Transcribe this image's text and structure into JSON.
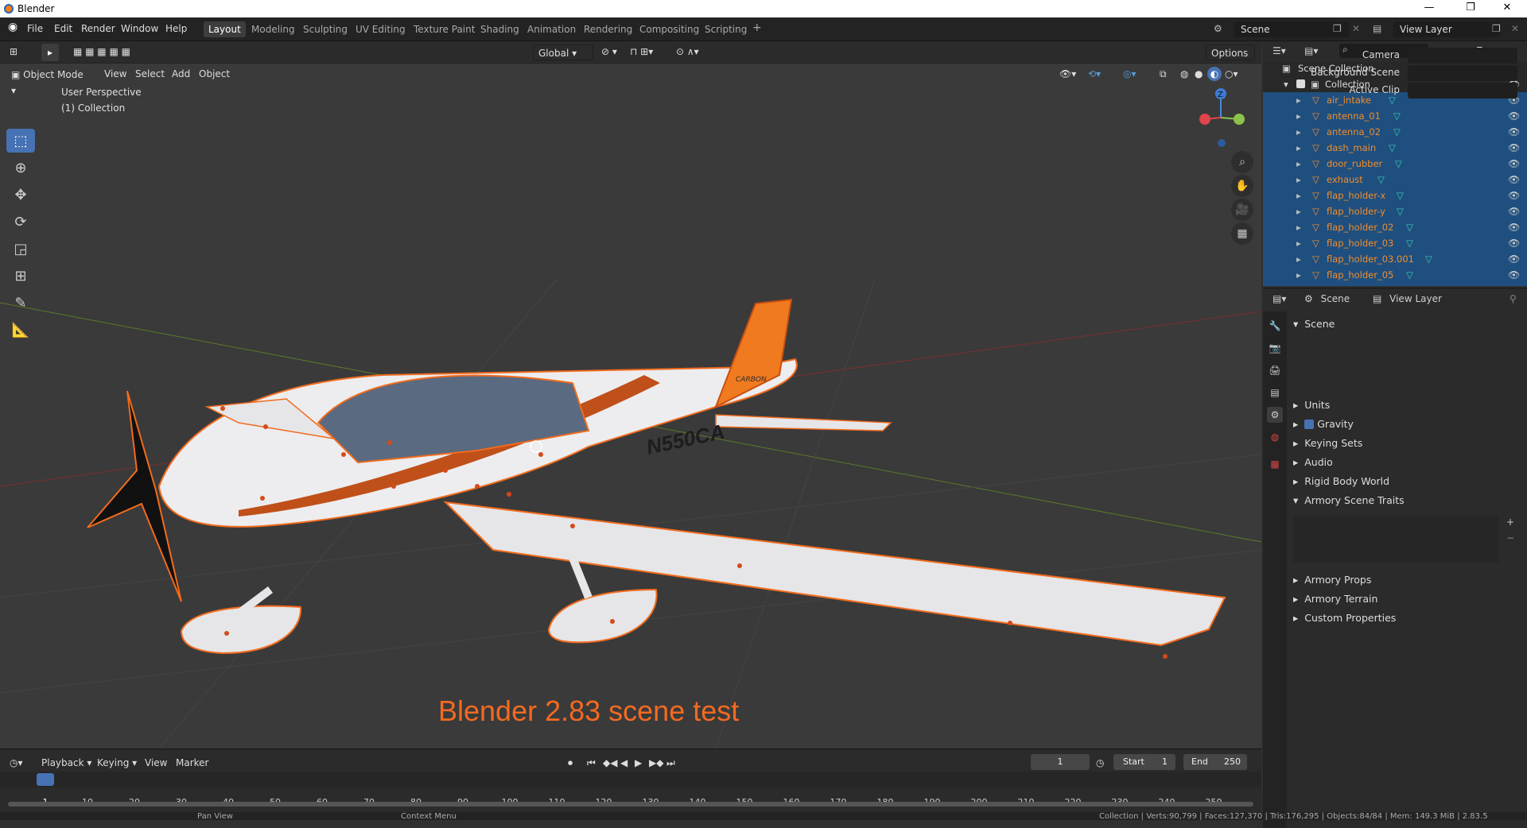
{
  "window": {
    "title": "Blender"
  },
  "menu": [
    "File",
    "Edit",
    "Render",
    "Window",
    "Help"
  ],
  "workspaces": [
    "Layout",
    "Modeling",
    "Sculpting",
    "UV Editing",
    "Texture Paint",
    "Shading",
    "Animation",
    "Rendering",
    "Compositing",
    "Scripting"
  ],
  "active_workspace": "Layout",
  "scene_field": "Scene",
  "viewlayer_field": "View Layer",
  "header": {
    "transform": "Global",
    "options": "Options"
  },
  "viewport_header": {
    "mode": "Object Mode",
    "items": [
      "View",
      "Select",
      "Add",
      "Object"
    ]
  },
  "overlay": {
    "line1": "User Perspective",
    "line2": "(1) Collection"
  },
  "caption": "Blender 2.83 scene test",
  "airplane": {
    "registration": "N550CA",
    "tail_text": "CARBON"
  },
  "gizmo": {
    "z": "Z"
  },
  "timeline": {
    "menus": [
      "Playback",
      "Keying",
      "View",
      "Marker"
    ],
    "current": "1",
    "start_label": "Start",
    "start": "1",
    "end_label": "End",
    "end": "250",
    "frames": [
      "1",
      "10",
      "20",
      "30",
      "40",
      "50",
      "60",
      "70",
      "80",
      "90",
      "100",
      "110",
      "120",
      "130",
      "140",
      "150",
      "160",
      "170",
      "180",
      "190",
      "200",
      "210",
      "220",
      "230",
      "240",
      "250"
    ]
  },
  "outliner": {
    "root": "Scene Collection",
    "collection": "Collection",
    "items": [
      "air_intake",
      "antenna_01",
      "antenna_02",
      "dash_main",
      "door_rubber",
      "exhaust",
      "flap_holder-x",
      "flap_holder-y",
      "flap_holder_02",
      "flap_holder_03",
      "flap_holder_03.001",
      "flap_holder_05"
    ]
  },
  "properties": {
    "tabs": {
      "scene": "Scene",
      "viewlayer": "View Layer"
    },
    "section": "Scene",
    "camera": "Camera",
    "background_scene": "Background Scene",
    "active_clip": "Active Clip",
    "panels": [
      "Units",
      "Gravity",
      "Keying Sets",
      "Audio",
      "Rigid Body World",
      "Armory Scene Traits"
    ],
    "panels2": [
      "Armory Props",
      "Armory Terrain",
      "Custom Properties"
    ]
  },
  "status": {
    "pan": "Pan View",
    "context": "Context Menu",
    "stats": "Collection | Verts:90,799 | Faces:127,370 | Tris:176,295 | Objects:84/84 | Mem: 149.3 MiB | 2.83.5"
  }
}
